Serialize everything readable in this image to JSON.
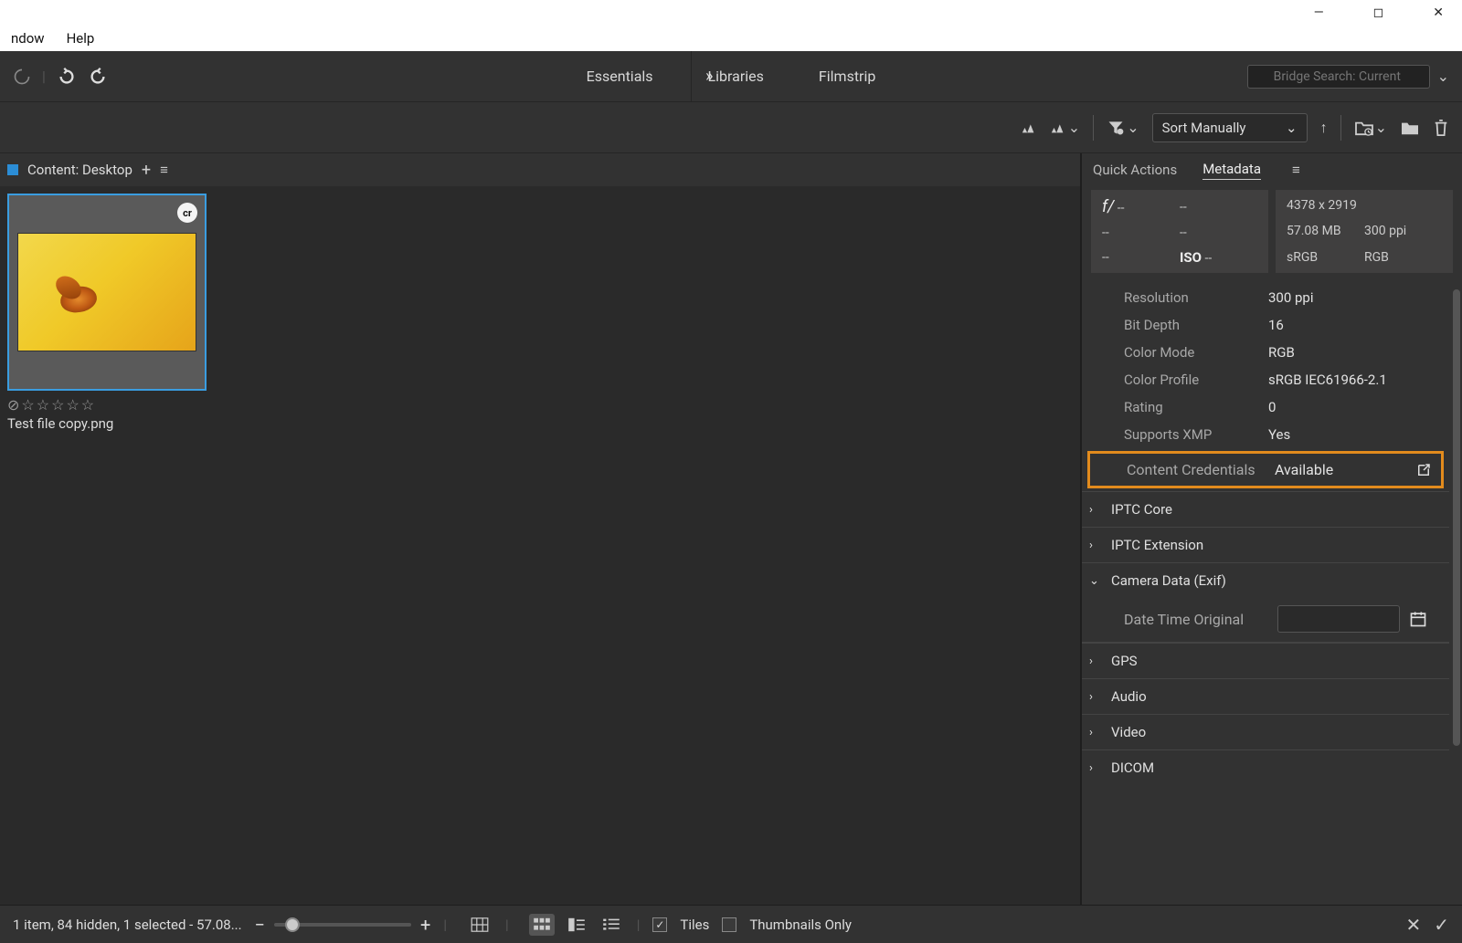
{
  "menubar": {
    "window": "ndow",
    "help": "Help"
  },
  "toolbar": {
    "tabs": {
      "essentials": "Essentials",
      "libraries": "Libraries",
      "filmstrip": "Filmstrip"
    },
    "search_placeholder": "Bridge Search: Current"
  },
  "toolbar2": {
    "sort_label": "Sort Manually"
  },
  "content": {
    "header": "Content: Desktop",
    "thumb_name": "Test file copy.png",
    "cr_badge": "cr"
  },
  "rightpanel": {
    "quick_actions": "Quick Actions",
    "metadata": "Metadata",
    "exif_left": {
      "f": "f/",
      "dash1": "--",
      "dash2": "--",
      "dash3": "--",
      "dash4": "--",
      "dash5": "--",
      "iso": "ISO",
      "iso_v": "--"
    },
    "exif_right": {
      "dim": "4378 x 2919",
      "size": "57.08 MB",
      "ppi": "300 ppi",
      "cs": "sRGB",
      "mode": "RGB"
    },
    "meta": {
      "resolution_l": "Resolution",
      "resolution_v": "300 ppi",
      "bitdepth_l": "Bit Depth",
      "bitdepth_v": "16",
      "colormode_l": "Color Mode",
      "colormode_v": "RGB",
      "colorprofile_l": "Color Profile",
      "colorprofile_v": "sRGB IEC61966-2.1",
      "rating_l": "Rating",
      "rating_v": "0",
      "supportsxmp_l": "Supports XMP",
      "supportsxmp_v": "Yes",
      "contentcred_l": "Content Credentials",
      "contentcred_v": "Available"
    },
    "sections": {
      "iptc_core": "IPTC Core",
      "iptc_ext": "IPTC Extension",
      "camera": "Camera Data (Exif)",
      "camera_datetime": "Date Time Original",
      "gps": "GPS",
      "audio": "Audio",
      "video": "Video",
      "dicom": "DICOM"
    }
  },
  "bottombar": {
    "status": "1 item, 84 hidden, 1 selected - 57.08...",
    "tiles": "Tiles",
    "thumbs_only": "Thumbnails Only"
  }
}
